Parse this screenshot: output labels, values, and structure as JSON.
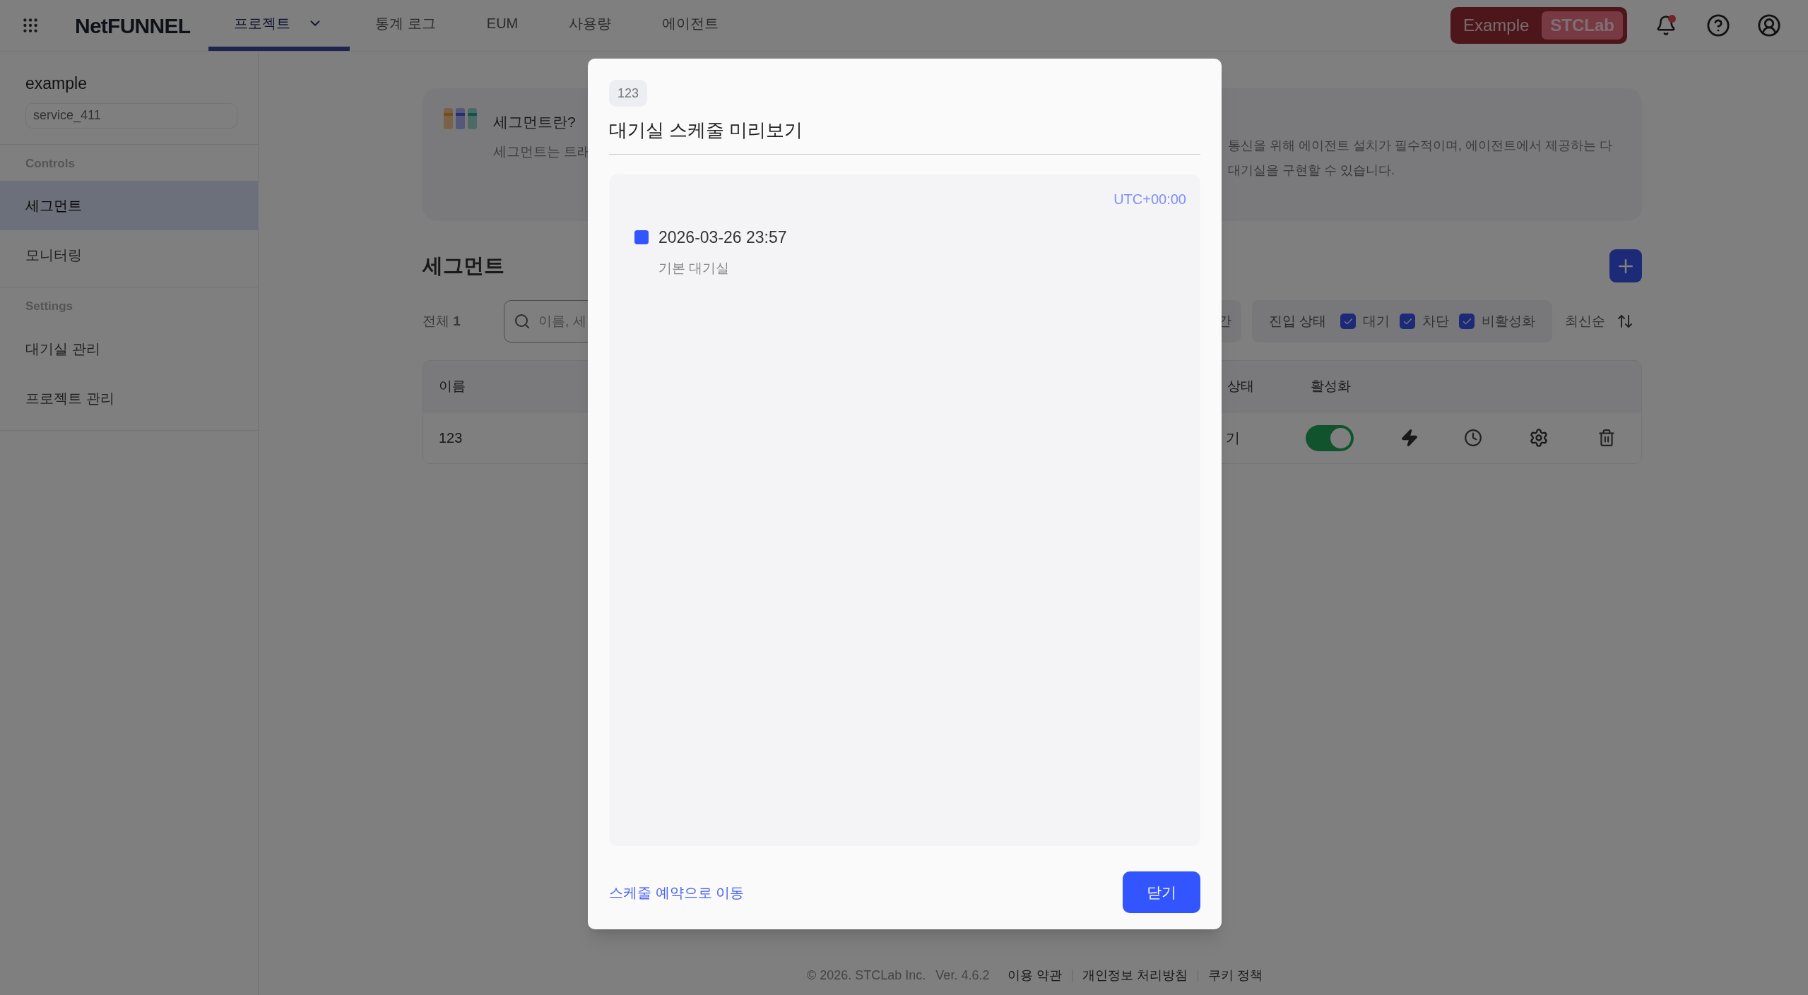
{
  "topbar": {
    "logo": "NetFUNNEL",
    "tabs": [
      {
        "label": "프로젝트",
        "selected": true,
        "dropdown": true
      },
      {
        "label": "통계 로그",
        "selected": false,
        "dropdown": false
      },
      {
        "label": "EUM",
        "selected": false,
        "dropdown": false
      },
      {
        "label": "사용량",
        "selected": false,
        "dropdown": false
      },
      {
        "label": "에이전트",
        "selected": false,
        "dropdown": false
      }
    ],
    "workspace": [
      {
        "label": "Example",
        "selected": false
      },
      {
        "label": "STCLab",
        "selected": true
      }
    ],
    "notification_unread": true
  },
  "sidebar": {
    "project": "example",
    "service": "service_411",
    "sections": [
      {
        "title": "Controls",
        "items": [
          {
            "label": "세그먼트",
            "selected": true
          },
          {
            "label": "모니터링",
            "selected": false
          }
        ]
      },
      {
        "title": "Settings",
        "items": [
          {
            "label": "대기실 관리",
            "selected": false
          },
          {
            "label": "프로젝트 관리",
            "selected": false
          }
        ]
      }
    ]
  },
  "info_card": {
    "title": "세그먼트란?",
    "description_left": "세그먼트는 트래",
    "description_right": [
      "통신을 위해 에이전트 설치가 필수적이며, 에이전트에서 제공하는 다",
      "대기실을 구현할 수 있습니다."
    ]
  },
  "segments": {
    "heading": "세그먼트",
    "total_label": "전체",
    "total": "1",
    "search_placeholder": "이름, 세",
    "period_filter": "간",
    "entry_filter": {
      "label": "진입 상태",
      "options": [
        {
          "label": "대기",
          "checked": true
        },
        {
          "label": "차단",
          "checked": true
        },
        {
          "label": "비활성화",
          "checked": true
        }
      ]
    },
    "sort": "최신순",
    "columns": [
      "이름",
      "상태",
      "활성화"
    ],
    "rows": [
      {
        "name": "123",
        "status": "기",
        "active": true
      }
    ]
  },
  "modal": {
    "tag": "123",
    "title": "대기실 스케줄 미리보기",
    "timezone": "UTC+00:00",
    "events": [
      {
        "time": "2026-03-26 23:57",
        "room": "기본 대기실",
        "color": "#3355ff"
      }
    ],
    "link": "스케줄 예약으로 이동",
    "close": "닫기"
  },
  "footer": {
    "copyright": "© 2026. STCLab Inc.",
    "version": "Ver. 4.6.2",
    "links": [
      "이용 약관",
      "개인정보 처리방침",
      "쿠키 정책"
    ]
  }
}
